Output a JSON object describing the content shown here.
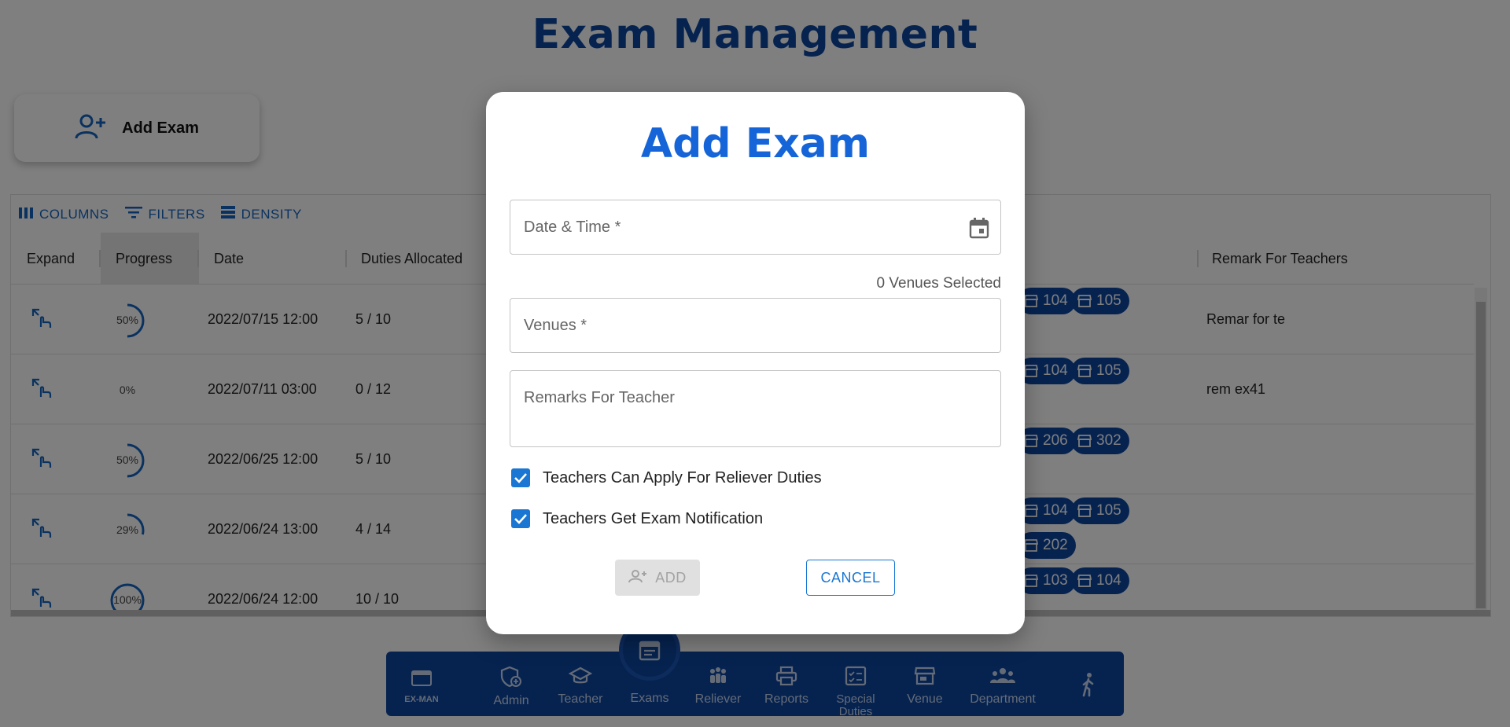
{
  "page": {
    "title": "Exam Management",
    "add_exam_label": "Add Exam"
  },
  "toolbar": {
    "columns": "COLUMNS",
    "filters": "FILTERS",
    "density": "DENSITY"
  },
  "table": {
    "headers": {
      "expand": "Expand",
      "progress": "Progress",
      "date": "Date",
      "duties": "Duties Allocated",
      "remark": "Remark For Teachers"
    },
    "rows": [
      {
        "progress_label": "50%",
        "progress": 0.5,
        "date": "2022/07/15 12:00",
        "duties": "5 / 10",
        "venues": [
          "104",
          "105"
        ],
        "remark": "Remar for te"
      },
      {
        "progress_label": "0%",
        "progress": 0,
        "date": "2022/07/11 03:00",
        "duties": "0 / 12",
        "venues": [
          "104",
          "105"
        ],
        "remark": "rem ex41"
      },
      {
        "progress_label": "50%",
        "progress": 0.5,
        "date": "2022/06/25 12:00",
        "duties": "5 / 10",
        "venues": [
          "206",
          "302"
        ],
        "remark": ""
      },
      {
        "progress_label": "29%",
        "progress": 0.29,
        "date": "2022/06/24 13:00",
        "duties": "4 / 14",
        "venues": [
          "104",
          "105",
          "202"
        ],
        "remark": ""
      },
      {
        "progress_label": "100%",
        "progress": 1,
        "date": "2022/06/24 12:00",
        "duties": "10 / 10",
        "venues": [
          "103",
          "104"
        ],
        "remark": ""
      }
    ]
  },
  "modal": {
    "title": "Add Exam",
    "date_time_placeholder": "Date & Time *",
    "venues_selected": "0 Venues Selected",
    "venues_placeholder": "Venues *",
    "remarks_placeholder": "Remarks For Teacher",
    "check_reliever": "Teachers Can Apply For Reliever Duties",
    "check_notification": "Teachers Get Exam Notification",
    "check_reliever_checked": true,
    "check_notification_checked": true,
    "add_label": "ADD",
    "cancel_label": "CANCEL"
  },
  "nav": {
    "logo_label": "EX-MAN",
    "items": [
      {
        "label": "Admin"
      },
      {
        "label": "Teacher"
      },
      {
        "label": "Exams"
      },
      {
        "label": "Reliever"
      },
      {
        "label": "Reports"
      },
      {
        "label": "Special Duties"
      },
      {
        "label": "Venue"
      },
      {
        "label": "Department"
      }
    ]
  },
  "colors": {
    "primary": "#0d47a1",
    "accent": "#1976d2",
    "title_blue": "#1565d8"
  }
}
